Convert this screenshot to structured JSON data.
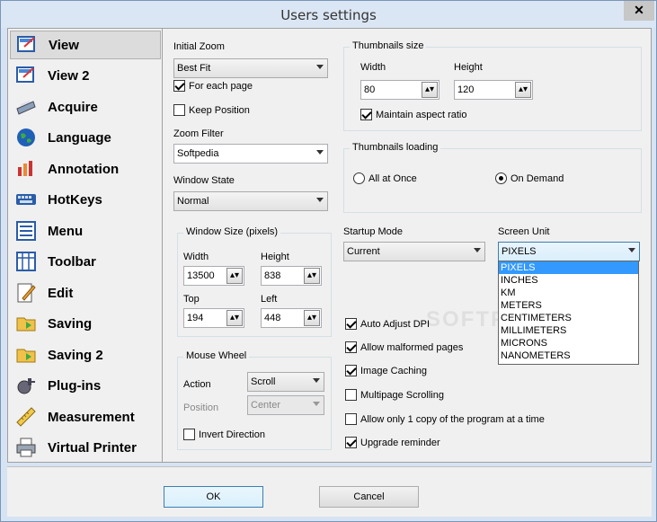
{
  "window": {
    "title": "Users settings",
    "close_glyph": "✕"
  },
  "sidebar": {
    "items": [
      {
        "label": "View",
        "icon": "view-icon"
      },
      {
        "label": "View 2",
        "icon": "view2-icon"
      },
      {
        "label": "Acquire",
        "icon": "scanner-icon"
      },
      {
        "label": "Language",
        "icon": "globe-icon"
      },
      {
        "label": "Annotation",
        "icon": "annotation-icon"
      },
      {
        "label": "HotKeys",
        "icon": "keyboard-icon"
      },
      {
        "label": "Menu",
        "icon": "menu-icon"
      },
      {
        "label": "Toolbar",
        "icon": "toolbar-icon"
      },
      {
        "label": "Edit",
        "icon": "edit-icon"
      },
      {
        "label": "Saving",
        "icon": "save-icon"
      },
      {
        "label": "Saving 2",
        "icon": "save2-icon"
      },
      {
        "label": "Plug-ins",
        "icon": "plugin-icon"
      },
      {
        "label": "Measurement",
        "icon": "ruler-icon"
      },
      {
        "label": "Virtual Printer",
        "icon": "printer-icon"
      }
    ]
  },
  "view": {
    "initial_zoom": {
      "label": "Initial Zoom",
      "value": "Best Fit"
    },
    "for_each_page": {
      "label": "For each page",
      "checked": true
    },
    "keep_position": {
      "label": "Keep Position",
      "checked": false
    },
    "zoom_filter": {
      "label": "Zoom Filter",
      "value": "Softpedia"
    },
    "window_state": {
      "label": "Window State",
      "value": "Normal"
    },
    "thumbnails_size": {
      "title": "Thumbnails size",
      "width_label": "Width",
      "width": "80",
      "height_label": "Height",
      "height": "120",
      "maintain_aspect": {
        "label": "Maintain aspect ratio",
        "checked": true
      }
    },
    "thumbnails_loading": {
      "title": "Thumbnails loading",
      "all_at_once": "All at Once",
      "on_demand": "On Demand",
      "selected": "On Demand"
    },
    "window_size": {
      "title": "Window Size (pixels)",
      "width_label": "Width",
      "width": "13500",
      "height_label": "Height",
      "height": "838",
      "top_label": "Top",
      "top": "194",
      "left_label": "Left",
      "left": "448"
    },
    "startup_mode": {
      "label": "Startup Mode",
      "value": "Current"
    },
    "screen_unit": {
      "label": "Screen Unit",
      "value": "PIXELS",
      "options": [
        "PIXELS",
        "INCHES",
        "KM",
        "METERS",
        "CENTIMETERS",
        "MILLIMETERS",
        "MICRONS",
        "NANOMETERS"
      ]
    },
    "mouse_wheel": {
      "title": "Mouse Wheel",
      "action_label": "Action",
      "action": "Scroll",
      "position_label": "Position",
      "position": "Center",
      "invert": {
        "label": "Invert Direction",
        "checked": false
      }
    },
    "options": [
      {
        "label": "Auto Adjust DPI",
        "checked": true
      },
      {
        "label": "Allow malformed pages",
        "checked": true
      },
      {
        "label": "Image Caching",
        "checked": true
      },
      {
        "label": "Multipage Scrolling",
        "checked": false
      },
      {
        "label": "Allow only 1 copy of the program at a time",
        "checked": false
      },
      {
        "label": "Upgrade reminder",
        "checked": true
      }
    ]
  },
  "buttons": {
    "ok": "OK",
    "cancel": "Cancel"
  },
  "watermark": "SOFTPEDIA"
}
